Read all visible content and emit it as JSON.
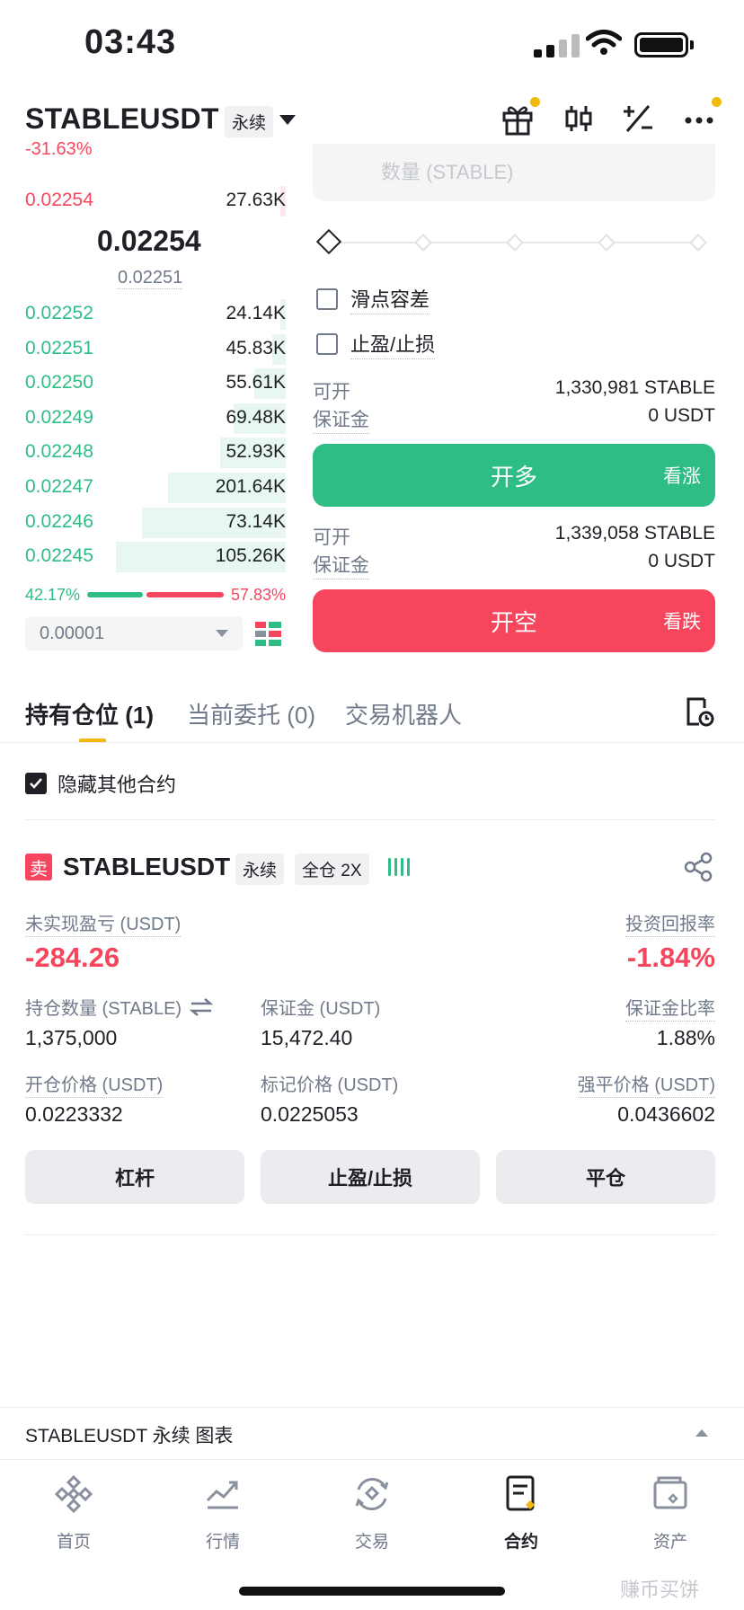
{
  "status": {
    "time": "03:43"
  },
  "header": {
    "symbol": "STABLEUSDT",
    "perp_tag": "永续",
    "change": "-31.63%",
    "icons": [
      "gift-icon",
      "candlestick-icon",
      "plus-minus-icon",
      "more-icon"
    ],
    "accent": "#f0b90b"
  },
  "orderbook": {
    "asks": [
      {
        "price": "0.02254",
        "qty": "27.63K"
      }
    ],
    "mid_price": "0.02254",
    "mark_price": "0.02251",
    "bids": [
      {
        "price": "0.02252",
        "qty": "24.14K",
        "depth": 0.02
      },
      {
        "price": "0.02251",
        "qty": "45.83K",
        "depth": 0.05
      },
      {
        "price": "0.02250",
        "qty": "55.61K",
        "depth": 0.12
      },
      {
        "price": "0.02249",
        "qty": "69.48K",
        "depth": 0.2
      },
      {
        "price": "0.02248",
        "qty": "52.93K",
        "depth": 0.25
      },
      {
        "price": "0.02247",
        "qty": "201.64K",
        "depth": 0.45
      },
      {
        "price": "0.02246",
        "qty": "73.14K",
        "depth": 0.55
      },
      {
        "price": "0.02245",
        "qty": "105.26K",
        "depth": 0.65
      }
    ],
    "buy_ratio": "42.17%",
    "sell_ratio": "57.83%",
    "buy_ratio_value": 42.17,
    "tick_size": "0.00001"
  },
  "form": {
    "qty_placeholder": "数量 (STABLE)",
    "slippage": "滑点容差",
    "tpsl": "止盈/止损",
    "long": {
      "avail_label": "可开",
      "avail_value": "1,330,981 STABLE",
      "margin_label": "保证金",
      "margin_value": "0 USDT",
      "button": "开多",
      "side": "看涨"
    },
    "short": {
      "avail_label": "可开",
      "avail_value": "1,339,058 STABLE",
      "margin_label": "保证金",
      "margin_value": "0 USDT",
      "button": "开空",
      "side": "看跌"
    },
    "colors": {
      "buy": "#2ebd85",
      "sell": "#f6465d"
    }
  },
  "tabs": [
    {
      "label": "持有仓位 (1)",
      "active": true
    },
    {
      "label": "当前委托 (0)",
      "active": false
    },
    {
      "label": "交易机器人",
      "active": false
    }
  ],
  "hide_others": "隐藏其他合约",
  "position": {
    "side_badge": "卖",
    "symbol": "STABLEUSDT",
    "tag_perp": "永续",
    "tag_margin": "全仓 2X",
    "pnl_label": "未实现盈亏 (USDT)",
    "pnl_value": "-284.26",
    "roi_label": "投资回报率",
    "roi_value": "-1.84%",
    "size_label": "持仓数量 (STABLE)",
    "size_value": "1,375,000",
    "margin_label": "保证金 (USDT)",
    "margin_value": "15,472.40",
    "margin_ratio_label": "保证金比率",
    "margin_ratio_value": "1.88%",
    "entry_label": "开仓价格 (USDT)",
    "entry_value": "0.0223332",
    "mark_label": "标记价格 (USDT)",
    "mark_value": "0.0225053",
    "liq_label": "强平价格 (USDT)",
    "liq_value": "0.0436602",
    "actions": [
      "杠杆",
      "止盈/止损",
      "平仓"
    ]
  },
  "chart_bar": "STABLEUSDT 永续  图表",
  "nav": [
    {
      "label": "首页",
      "icon": "home-icon"
    },
    {
      "label": "行情",
      "icon": "markets-icon"
    },
    {
      "label": "交易",
      "icon": "trade-icon"
    },
    {
      "label": "合约",
      "icon": "futures-icon",
      "active": true
    },
    {
      "label": "资产",
      "icon": "wallet-icon"
    }
  ],
  "watermark": "赚币买饼"
}
